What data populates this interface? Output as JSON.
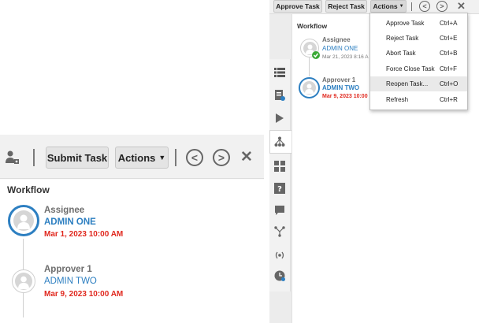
{
  "left_panel": {
    "toolbar": {
      "submit_label": "Submit Task",
      "actions_label": "Actions",
      "prev_glyph": "<",
      "next_glyph": ">",
      "close_glyph": "✕",
      "person_icon": "user-settings-icon"
    },
    "workflow": {
      "title": "Workflow",
      "steps": [
        {
          "role": "Assignee",
          "user": "ADMIN ONE",
          "date": "Mar 1, 2023 10:00 AM"
        },
        {
          "role": "Approver 1",
          "user": "ADMIN TWO",
          "date": "Mar 9, 2023 10:00 AM"
        }
      ]
    }
  },
  "right_panel": {
    "toolbar": {
      "approve_label": "Approve Task",
      "reject_label": "Reject Task",
      "actions_label": "Actions",
      "prev_glyph": "<",
      "next_glyph": ">",
      "close_glyph": "✕"
    },
    "menu": {
      "items": [
        {
          "label": "Approve Task",
          "shortcut": "Ctrl+A"
        },
        {
          "label": "Reject Task",
          "shortcut": "Ctrl+E"
        },
        {
          "label": "Abort Task",
          "shortcut": "Ctrl+B"
        },
        {
          "label": "Force Close Task",
          "shortcut": "Ctrl+F"
        },
        {
          "label": "Reopen Task...",
          "shortcut": "Ctrl+O"
        },
        {
          "label": "Refresh",
          "shortcut": "Ctrl+R"
        }
      ]
    },
    "workflow": {
      "title": "Workflow",
      "steps": [
        {
          "role": "Assignee",
          "user": "ADMIN ONE",
          "date": "Mar 21, 2023 8:16 A"
        },
        {
          "role": "Approver 1",
          "user": "ADMIN TWO",
          "date": "Mar 9, 2023 10:00"
        }
      ]
    },
    "side_icons": [
      "list-icon",
      "document-icon",
      "play-icon",
      "hierarchy-icon",
      "grid-icon",
      "help-icon",
      "comment-icon",
      "network-icon",
      "signal-icon",
      "clock-icon"
    ]
  },
  "colors": {
    "user_link": "#2d7fc1",
    "date_red": "#e0281e",
    "active_ring": "#2d7fc1",
    "check_green": "#3aa935"
  }
}
